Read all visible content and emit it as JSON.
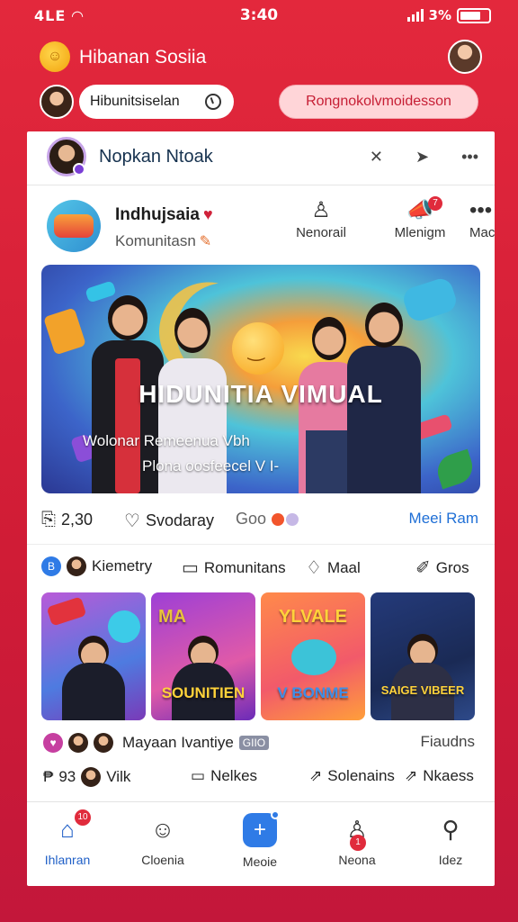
{
  "status_bar": {
    "carrier": "4LЕ",
    "time": "3:40",
    "battery_text": "3%"
  },
  "header": {
    "app_title": "Hibanan Sosiia",
    "search_text": "Hibunitsiselan",
    "cta_label": "Rongnokolvmoidesson"
  },
  "group": {
    "name": "Nopkan Ntoak"
  },
  "post": {
    "title": "Indhujsaia",
    "subtitle": "Komunitasn",
    "actions": [
      {
        "label": "Nenorail",
        "icon": "bell-icon"
      },
      {
        "label": "Mlenigm",
        "icon": "megaphone-icon",
        "badge": "7"
      },
      {
        "label": "Mac",
        "icon": "more-icon"
      }
    ]
  },
  "banner": {
    "title": "HIDUNITIA VIMUAL",
    "line1": "Wolonar Remeenua Vbh",
    "line2": "Plona oosfeecel V I-"
  },
  "stats": {
    "count": "2,30",
    "save_label": "Svodaray",
    "reacts_label": "Goo",
    "more_label": "Meei Ram"
  },
  "actions": {
    "kiemetry": "Kiemetry",
    "komunitans": "Romunitans",
    "maal": "Maal",
    "gros": "Gros"
  },
  "tiles": [
    {
      "label": ""
    },
    {
      "label_top": "MA",
      "label": "SOUNITIEN"
    },
    {
      "label_top": "YLVALE",
      "label": "V BONME"
    },
    {
      "label": "SAIGE VIBEER"
    }
  ],
  "meta1": {
    "name": "Mayaan Ivantiye",
    "tag": "GIIO",
    "right": "Fiaudns"
  },
  "meta2": {
    "count": "93",
    "vilk": "Vilk",
    "nelkes": "Nelkes",
    "solenains": "Solenains",
    "nkaess": "Nkaess"
  },
  "nav": [
    {
      "label": "Ihlanran",
      "icon": "home-icon",
      "badge": "10",
      "active": true
    },
    {
      "label": "Cloenia",
      "icon": "chat-icon"
    },
    {
      "label": "Meoie",
      "icon": "plus-icon"
    },
    {
      "label": "Neona",
      "icon": "person-icon",
      "badge": "1"
    },
    {
      "label": "Idez",
      "icon": "search-icon"
    }
  ],
  "colors": {
    "primary_red": "#e3283c",
    "accent_blue": "#2f7be6",
    "link_blue": "#1f6fd6"
  }
}
